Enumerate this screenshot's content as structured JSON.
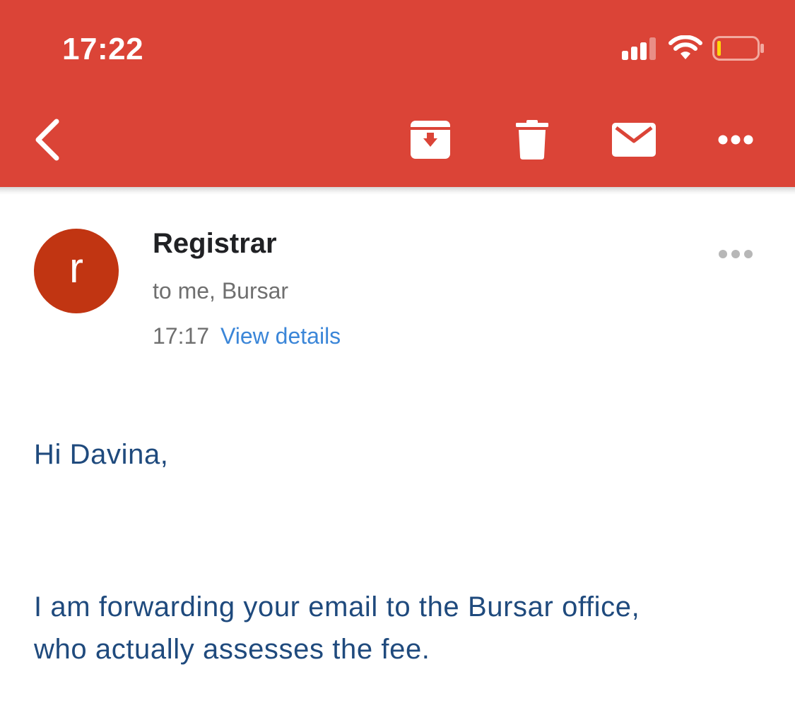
{
  "status_bar": {
    "time": "17:22",
    "icons": [
      "signal-icon",
      "wifi-icon",
      "battery-low-icon"
    ]
  },
  "toolbar": {
    "icons": [
      "back-icon",
      "archive-icon",
      "delete-icon",
      "mark-unread-icon",
      "more-icon"
    ],
    "bar_color": "#db4437"
  },
  "email": {
    "avatar_letter": "r",
    "avatar_color": "#c13512",
    "sender": "Registrar",
    "recipients": "to me, Bursar",
    "time": "17:17",
    "view_details": "View details",
    "body": {
      "greeting": "Hi Davina,",
      "line1": "I am forwarding your email to the Bursar office,",
      "line2": "who actually assesses the fee."
    }
  }
}
